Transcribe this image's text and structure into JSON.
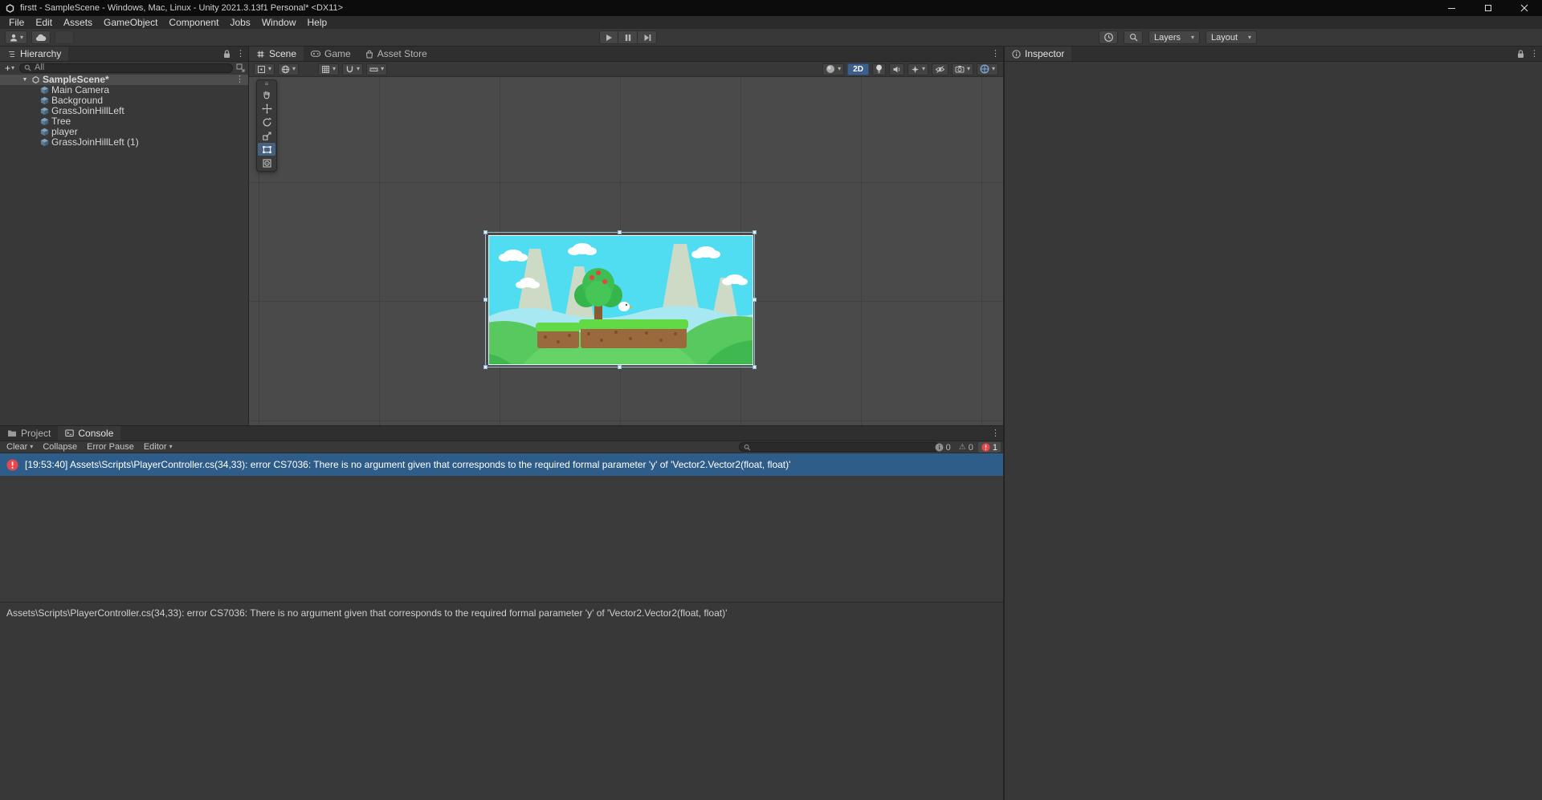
{
  "window": {
    "title": "firstt - SampleScene - Windows, Mac, Linux - Unity 2021.3.13f1 Personal* <DX11>"
  },
  "menu": {
    "items": [
      "File",
      "Edit",
      "Assets",
      "GameObject",
      "Component",
      "Jobs",
      "Window",
      "Help"
    ]
  },
  "toolbar": {
    "layers": "Layers",
    "layout": "Layout"
  },
  "hierarchy": {
    "tab_label": "Hierarchy",
    "create_label": "+",
    "search_label": "All",
    "scene_name": "SampleScene*",
    "items": [
      {
        "label": "Main Camera"
      },
      {
        "label": "Background"
      },
      {
        "label": "GrassJoinHillLeft"
      },
      {
        "label": "Tree"
      },
      {
        "label": "player"
      },
      {
        "label": "GrassJoinHillLeft (1)"
      }
    ]
  },
  "scene": {
    "tabs": [
      {
        "label": "Scene"
      },
      {
        "label": "Game"
      },
      {
        "label": "Asset Store"
      }
    ],
    "mode_2d_label": "2D"
  },
  "inspector": {
    "tab_label": "Inspector"
  },
  "bottom": {
    "tabs": [
      {
        "label": "Project"
      },
      {
        "label": "Console"
      }
    ],
    "console": {
      "clear_label": "Clear",
      "collapse_label": "Collapse",
      "error_pause_label": "Error Pause",
      "editor_label": "Editor",
      "info_count": "0",
      "warning_count": "0",
      "error_count": "1",
      "selected_entry": "[19:53:40] Assets\\Scripts\\PlayerController.cs(34,33): error CS7036: There is no argument given that corresponds to the required formal parameter 'y' of 'Vector2.Vector2(float, float)'",
      "detail": "Assets\\Scripts\\PlayerController.cs(34,33): error CS7036: There is no argument given that corresponds to the required formal parameter 'y' of 'Vector2.Vector2(float, float)'"
    }
  },
  "icons": {
    "caret_down": "▾",
    "kebab": "⋮",
    "foldout_open": "▼",
    "grip": "≡",
    "warning": "⚠"
  },
  "colors": {
    "selection_blue": "#2f5d8a",
    "hierarchy_selection_gray": "#4d4d4d",
    "error_red": "#e5484d",
    "active_toggle_blue": "#3e5f8a",
    "sky_cyan": "#50ddf1"
  }
}
